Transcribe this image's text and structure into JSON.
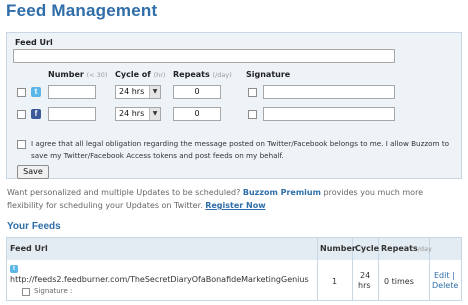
{
  "page": {
    "title": "Feed Management"
  },
  "form": {
    "feed_url_label": "Feed Url",
    "feed_url_value": "",
    "columns": {
      "number": "Number",
      "number_hint": "(< 30)",
      "cycle": "Cycle of",
      "cycle_hint": "(hr)",
      "repeats": "Repeats",
      "repeats_hint": "(/day)",
      "signature": "Signature"
    },
    "twitter_row": {
      "number": "",
      "cycle": "24 hrs",
      "repeats": "0",
      "signature": ""
    },
    "facebook_row": {
      "number": "",
      "cycle": "24 hrs",
      "repeats": "0",
      "signature": ""
    },
    "agree_text": "I agree that all legal obligation regarding the message posted on Twitter/Facebook belongs to me. I allow Buzzom to save my Twitter/Facebook Access tokens and post feeds on my behalf.",
    "save_label": "Save"
  },
  "promo": {
    "line1_pre": "Want personalized and multiple Updates to be scheduled? ",
    "brand": "Buzzom Premium",
    "line1_post": " provides you much more flexibility for scheduling your Updates on Twitter. ",
    "register": "Register Now"
  },
  "feeds": {
    "title": "Your Feeds",
    "headers": {
      "feed_url": "Feed Url",
      "number": "Number",
      "cycle": "Cycle",
      "repeats": "Repeats",
      "repeats_hint": "/day"
    },
    "rows": [
      {
        "url": "http://feeds2.feedburner.com/TheSecretDiaryOfaBonafideMarketingGenius",
        "signature_label": "Signature :",
        "number": "1",
        "cycle": "24",
        "cycle_unit": "hrs",
        "repeats": "0 times",
        "edit": "Edit |",
        "delete": "Delete"
      }
    ]
  },
  "colors": {
    "accent": "#2f6ea8",
    "panel": "#eef3f8",
    "twitter": "#5bb7e8",
    "facebook": "#3b5998"
  }
}
